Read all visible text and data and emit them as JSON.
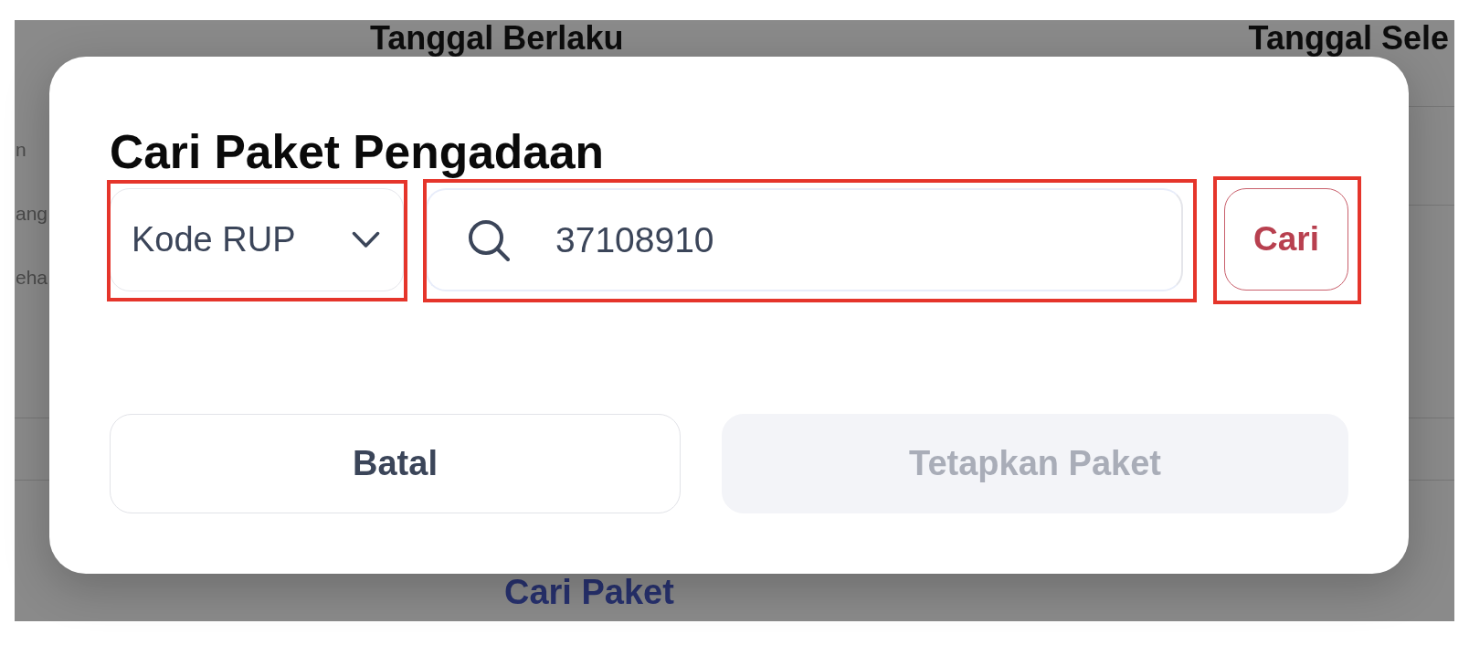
{
  "backdrop": {
    "column_headers": [
      "Tanggal Berlaku",
      "Tanggal Sele"
    ],
    "left_column_fragments": [
      "n",
      "ang",
      "eha"
    ],
    "link": "Cari Paket"
  },
  "dialog": {
    "title": "Cari Paket Pengadaan",
    "filter": {
      "value": "Kode RUP",
      "highlighted": true
    },
    "search": {
      "value": "37108910",
      "highlighted": true
    },
    "search_button": {
      "label": "Cari",
      "highlighted": true
    },
    "actions": [
      {
        "label": "Batal",
        "kind": "secondary",
        "disabled": false
      },
      {
        "label": "Tetapkan Paket",
        "kind": "primary",
        "disabled": true
      }
    ]
  }
}
